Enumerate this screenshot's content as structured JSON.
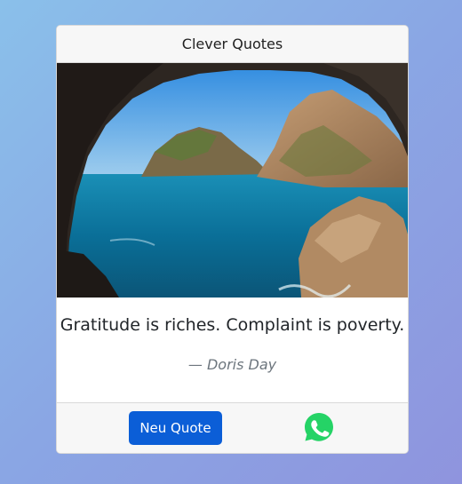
{
  "header": {
    "title": "Clever Quotes"
  },
  "quote": {
    "text": "Gratitude is riches. Complaint is poverty.",
    "author": "— Doris Day"
  },
  "footer": {
    "new_quote_label": "Neu Quote",
    "share_icon": "whatsapp-icon"
  },
  "colors": {
    "primary_button": "#0b5ed7",
    "whatsapp": "#25d366"
  },
  "image": {
    "subject": "sea-cave-landscape"
  }
}
